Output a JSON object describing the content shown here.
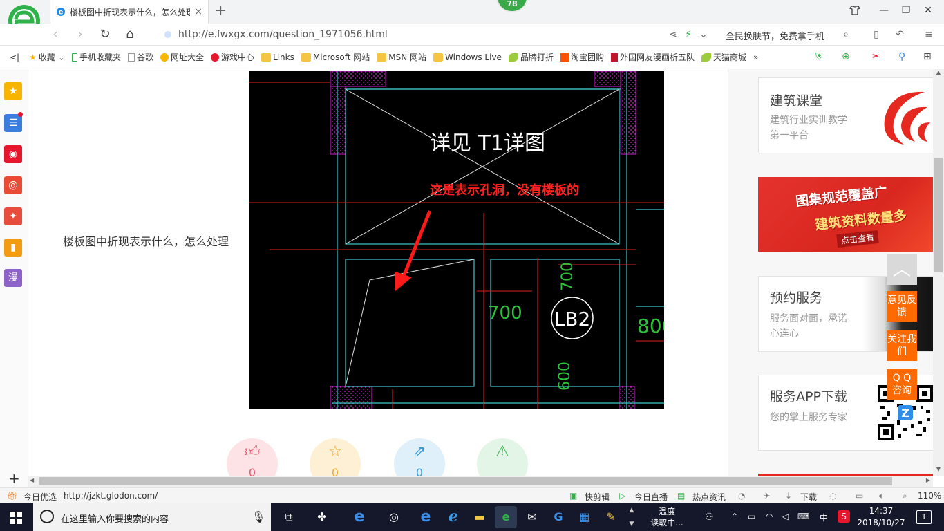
{
  "browser": {
    "tab_title": "楼板图中折现表示什么，怎么处理",
    "tab_close": "×",
    "new_tab": "+",
    "badge_count": "78",
    "url": "http://e.fwxgx.com/question_1971056.html",
    "promo_text": "全民换肤节，免费拿手机"
  },
  "bookmarks": [
    {
      "label": "收藏",
      "icon": "star-icon"
    },
    {
      "label": "手机收藏夹",
      "icon": "phone-icon"
    },
    {
      "label": "谷歌",
      "icon": "page-icon"
    },
    {
      "label": "网址大全",
      "icon": "globe-icon"
    },
    {
      "label": "游戏中心",
      "icon": "game-icon"
    },
    {
      "label": "Links",
      "icon": "folder-icon"
    },
    {
      "label": "Microsoft 网站",
      "icon": "folder-icon"
    },
    {
      "label": "MSN 网站",
      "icon": "folder-icon"
    },
    {
      "label": "Windows Live",
      "icon": "folder-icon"
    },
    {
      "label": "品牌打折",
      "icon": "leaf-icon"
    },
    {
      "label": "淘宝团购",
      "icon": "taobao-icon"
    },
    {
      "label": "外国网友漫画析五队",
      "icon": "bookmark-icon"
    },
    {
      "label": "天猫商城",
      "icon": "leaf-icon"
    }
  ],
  "sidebar": {
    "items": [
      {
        "name": "favorites-icon",
        "color": "#f7b500",
        "glyph": "★"
      },
      {
        "name": "news-icon",
        "color": "#3b7ddd",
        "glyph": "☰"
      },
      {
        "name": "weibo-icon",
        "color": "#e6162d",
        "glyph": "◉"
      },
      {
        "name": "mail-icon",
        "color": "#e94b35",
        "glyph": "@"
      },
      {
        "name": "game-icon",
        "color": "#e74c3c",
        "glyph": "✦"
      },
      {
        "name": "reader-icon",
        "color": "#f39c12",
        "glyph": "▮"
      },
      {
        "name": "comic-icon",
        "color": "#8e63c9",
        "glyph": "漫"
      }
    ],
    "add": "+"
  },
  "content": {
    "question_title": "楼板图中折现表示什么，怎么处理",
    "cad": {
      "detail_label": "详见 T1详图",
      "annotation": "这是表示孔洞，没有楼板的",
      "dim_700_a": "700",
      "dim_700_b": "700",
      "slab_label": "LB2",
      "dim_800": "800",
      "dim_600": "600"
    },
    "actions": [
      {
        "name": "like-button",
        "icon": "thumbs-up-icon",
        "count": "0",
        "bg": "#fde3e6",
        "fg": "#e8566c"
      },
      {
        "name": "favorite-button",
        "icon": "star-icon",
        "count": "0",
        "bg": "#fdf0d5",
        "fg": "#f0a830"
      },
      {
        "name": "share-button",
        "icon": "share-icon",
        "count": "0",
        "bg": "#dff0fb",
        "fg": "#3a9bdc"
      },
      {
        "name": "report-button",
        "icon": "warning-icon",
        "count": "",
        "bg": "#e2f5e6",
        "fg": "#39b54a"
      }
    ]
  },
  "right": {
    "card1": {
      "title": "建筑课堂",
      "desc": "建筑行业实训教学第一平台"
    },
    "banner": {
      "line1": "图集规范覆盖广",
      "line2": "建筑资料数量多",
      "cta": "点击查看"
    },
    "card2": {
      "title": "预约服务",
      "desc": "服务面对面，承诺心连心"
    },
    "card3": {
      "title": "服务APP下载",
      "desc": "您的掌上服务专家"
    },
    "float": {
      "feedback": "意见反馈",
      "follow": "关注我们",
      "qq": "Q Q 咨询"
    }
  },
  "status": {
    "left_label": "今日优选",
    "url": "http://jzkt.glodon.com/",
    "items": [
      "快剪辑",
      "今日直播",
      "热点资讯",
      "下载"
    ],
    "zoom": "110%"
  },
  "taskbar": {
    "search_placeholder": "在这里输入你要搜索的内容",
    "weather_line1": "温度",
    "weather_line2": "读取中...",
    "ime": "中",
    "time": "14:37",
    "date": "2018/10/27",
    "notif_count": "1"
  }
}
